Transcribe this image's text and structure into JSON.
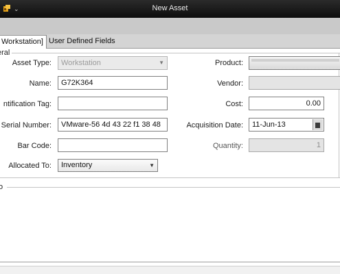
{
  "window": {
    "title": "New Asset",
    "icon": "app-icon"
  },
  "tabs": [
    {
      "label": "Workstation]",
      "active": true
    },
    {
      "label": "User Defined Fields",
      "active": false
    }
  ],
  "general": {
    "group_title": "eral",
    "left": {
      "asset_type": {
        "label": "Asset Type:",
        "value": "Workstation"
      },
      "name": {
        "label": "Name:",
        "value": "G72K364"
      },
      "identification_tag": {
        "label": "ntification Tag:",
        "value": ""
      },
      "serial_number": {
        "label": "Serial Number:",
        "value": "VMware-56 4d 43 22 f1 38 48"
      },
      "bar_code": {
        "label": "Bar Code:",
        "value": ""
      },
      "allocated_to": {
        "label": "Allocated To:",
        "value": "Inventory"
      }
    },
    "right": {
      "product": {
        "label": "Product:",
        "value": ""
      },
      "vendor": {
        "label": "Vendor:",
        "value": ""
      },
      "cost": {
        "label": "Cost:",
        "value": "0.00"
      },
      "acquisition_date": {
        "label": "Acquisition Date:",
        "value": "11-Jun-13"
      },
      "quantity": {
        "label": "Quantity:",
        "value": "1"
      }
    }
  },
  "memo": {
    "label": "o"
  },
  "colors": {
    "titlebar": "#111111",
    "band": "#c9c9c9",
    "tabstrip": "#d4d4d4"
  }
}
